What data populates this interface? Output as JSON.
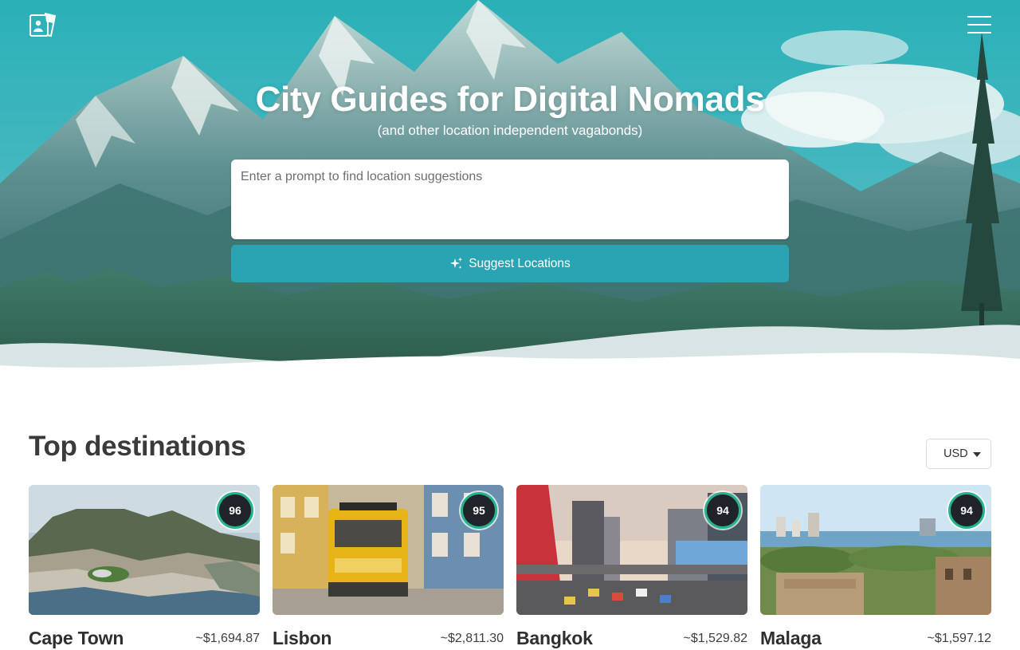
{
  "header": {
    "logo_icon": "nomad-card-logo-icon",
    "menu_icon": "hamburger-menu-icon"
  },
  "hero": {
    "title": "City Guides for Digital Nomads",
    "subtitle": "(and other location independent vagabonds)",
    "prompt_placeholder": "Enter a prompt to find location suggestions",
    "prompt_value": "",
    "suggest_button_label": "Suggest Locations",
    "suggest_icon": "sparkles-icon"
  },
  "destinations": {
    "title": "Top destinations",
    "currency": "USD",
    "cards": [
      {
        "name": "Cape Town",
        "score": "96",
        "cost": "~$1,694.87"
      },
      {
        "name": "Lisbon",
        "score": "95",
        "cost": "~$2,811.30"
      },
      {
        "name": "Bangkok",
        "score": "94",
        "cost": "~$1,529.82"
      },
      {
        "name": "Malaga",
        "score": "94",
        "cost": "~$1,597.12"
      }
    ]
  },
  "colors": {
    "accent": "#2aa3b2",
    "score_ring": "#24b38a",
    "heading": "#3a3a3a"
  }
}
